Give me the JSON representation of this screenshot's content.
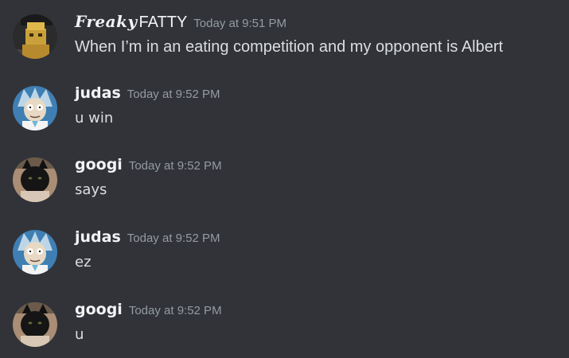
{
  "messages": [
    {
      "username_styled": "Freaky",
      "username_plain": "FATTY",
      "timestamp": "Today at 9:51 PM",
      "content": "When I’m in an eating competition and my opponent is Albert",
      "avatar_icon": "roblox-character-avatar-icon"
    },
    {
      "username": "judas",
      "timestamp": "Today at 9:52 PM",
      "content": "u win",
      "avatar_icon": "rick-sanchez-avatar-icon"
    },
    {
      "username": "googi",
      "timestamp": "Today at 9:52 PM",
      "content": "says",
      "avatar_icon": "black-cat-avatar-icon"
    },
    {
      "username": "judas",
      "timestamp": "Today at 9:52 PM",
      "content": "ez",
      "avatar_icon": "rick-sanchez-avatar-icon"
    },
    {
      "username": "googi",
      "timestamp": "Today at 9:52 PM",
      "content": "u",
      "avatar_icon": "black-cat-avatar-icon"
    }
  ],
  "colors": {
    "background": "#313338",
    "username": "#f2f3f5",
    "timestamp": "#949ba4",
    "message_text": "#dbdee1"
  }
}
